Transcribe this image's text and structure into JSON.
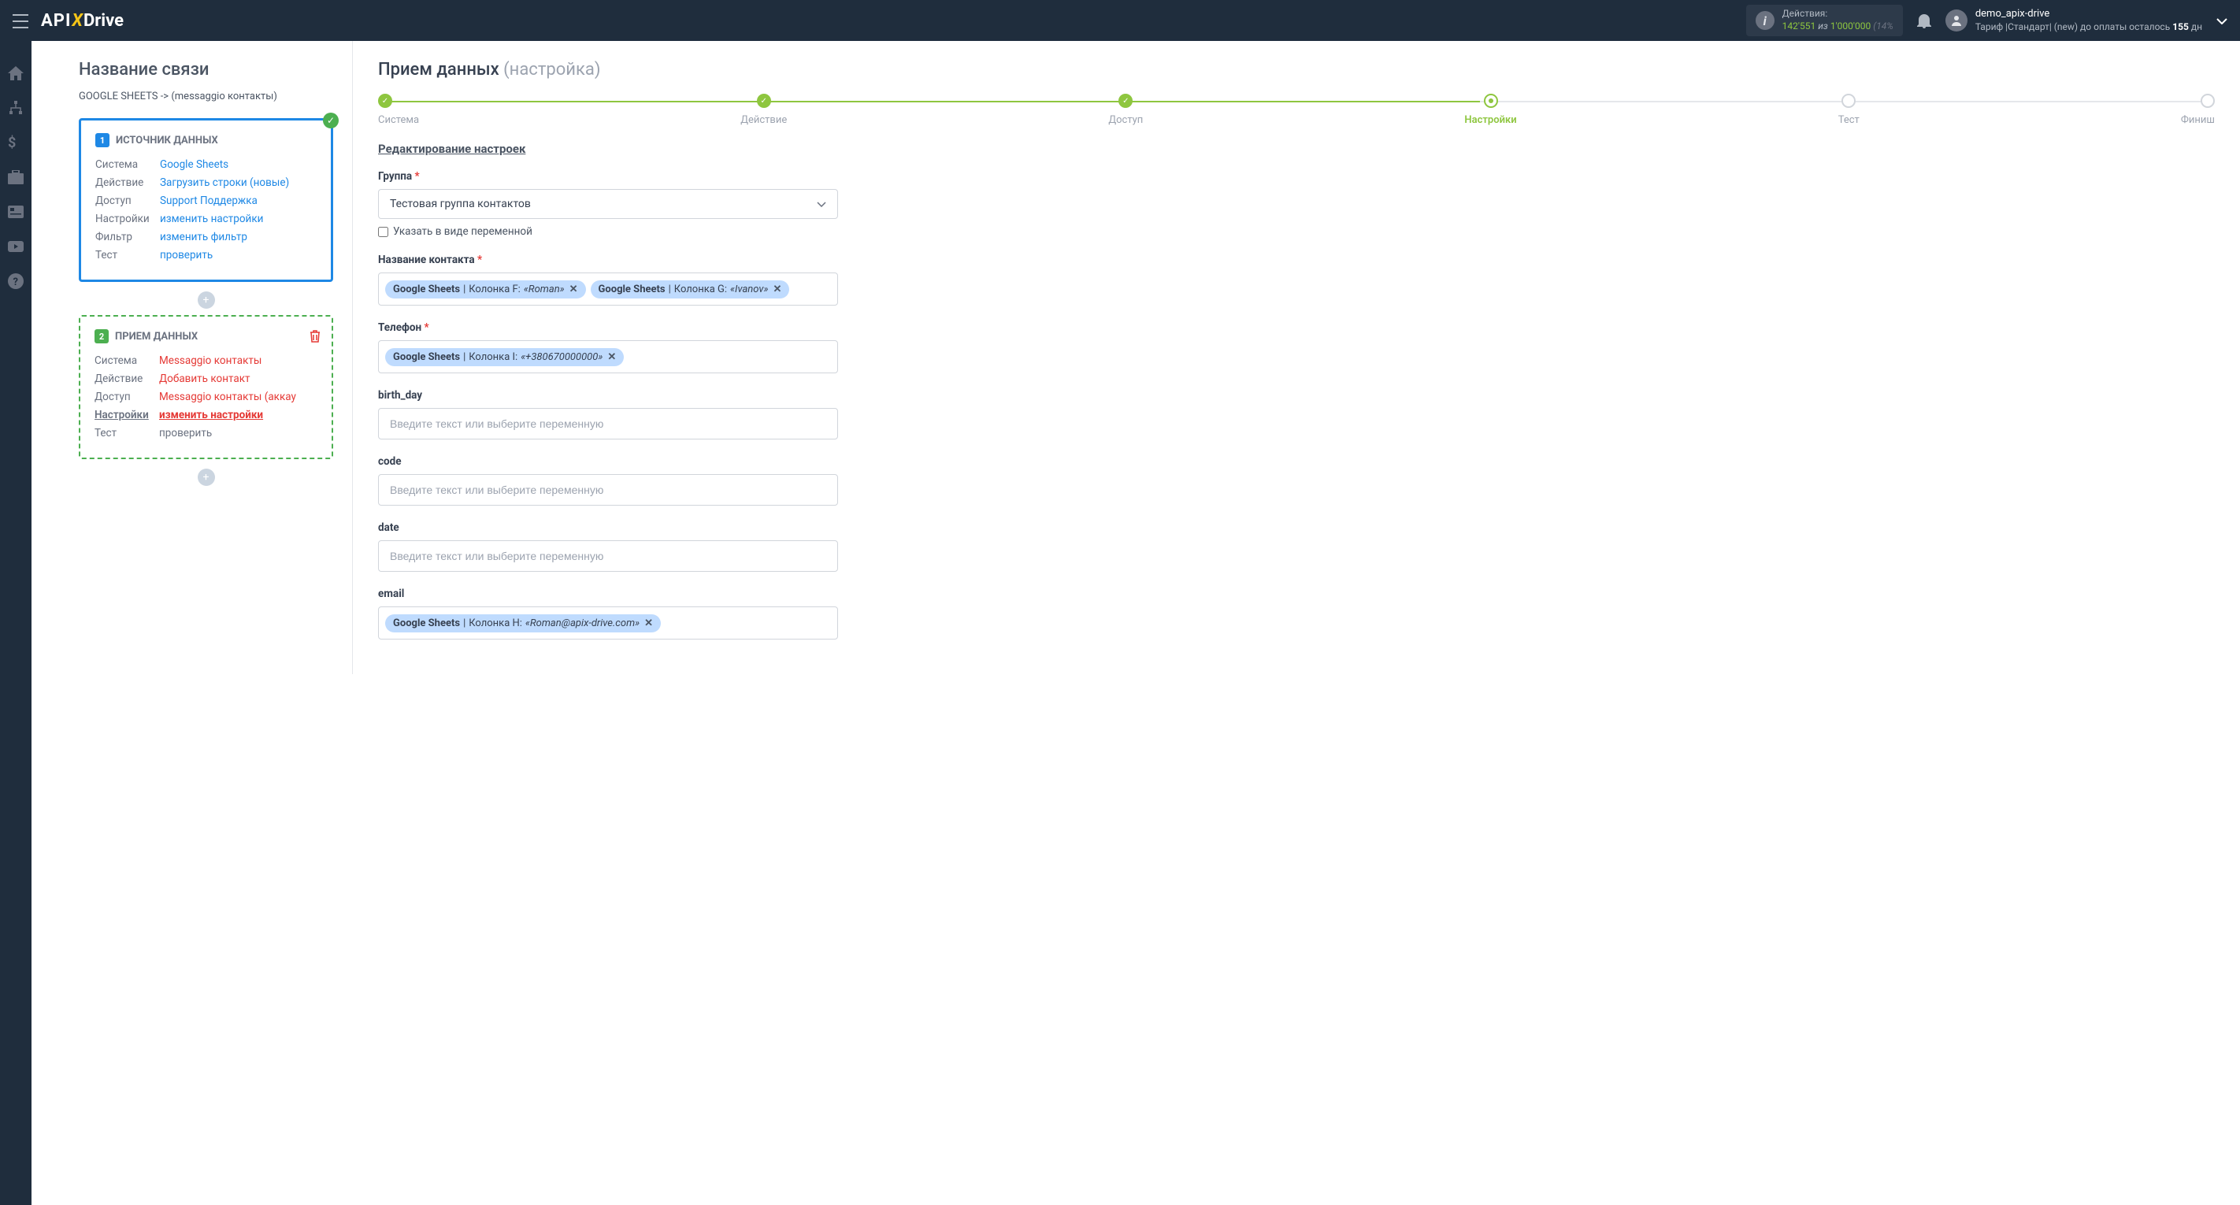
{
  "header": {
    "logo_api": "API",
    "logo_x": "X",
    "logo_drive": "Drive",
    "actions_label": "Действия:",
    "actions_count": "142'551",
    "actions_of": "из",
    "actions_total": "1'000'000",
    "actions_pct": "(14%",
    "user_name": "demo_apix-drive",
    "user_tariff_prefix": "Тариф |Стандарт| (new) до оплаты осталось ",
    "user_tariff_days": "155",
    "user_tariff_suffix": " дн"
  },
  "left": {
    "title": "Название связи",
    "subtitle": "GOOGLE SHEETS -> (messaggio контакты)",
    "source": {
      "num": "1",
      "header": "ИСТОЧНИК ДАННЫХ",
      "rows": [
        {
          "label": "Система",
          "value": "Google Sheets",
          "cls": ""
        },
        {
          "label": "Действие",
          "value": "Загрузить строки (новые)",
          "cls": ""
        },
        {
          "label": "Доступ",
          "value": "Support Поддержка",
          "cls": ""
        },
        {
          "label": "Настройки",
          "value": "изменить настройки",
          "cls": ""
        },
        {
          "label": "Фильтр",
          "value": "изменить фильтр",
          "cls": ""
        },
        {
          "label": "Тест",
          "value": "проверить",
          "cls": ""
        }
      ]
    },
    "receive": {
      "num": "2",
      "header": "ПРИЕМ ДАННЫХ",
      "rows": [
        {
          "label": "Система",
          "value": "Messaggio контакты",
          "cls": "red"
        },
        {
          "label": "Действие",
          "value": "Добавить контакт",
          "cls": "red"
        },
        {
          "label": "Доступ",
          "value": "Messaggio контакты (аккау",
          "cls": "red"
        },
        {
          "label": "Настройки",
          "value": "изменить настройки",
          "cls": "active",
          "labelcls": "active"
        },
        {
          "label": "Тест",
          "value": "проверить",
          "cls": "gray"
        }
      ]
    }
  },
  "right": {
    "title": "Прием данных",
    "title_sub": "(настройка)",
    "steps": [
      {
        "label": "Система",
        "state": "done"
      },
      {
        "label": "Действие",
        "state": "done"
      },
      {
        "label": "Доступ",
        "state": "done"
      },
      {
        "label": "Настройки",
        "state": "current"
      },
      {
        "label": "Тест",
        "state": "pending"
      },
      {
        "label": "Финиш",
        "state": "pending"
      }
    ],
    "section_title": "Редактирование настроек",
    "group": {
      "label": "Группа",
      "value": "Тестовая группа контактов",
      "checkbox": "Указать в виде переменной"
    },
    "fields": [
      {
        "label": "Название контакта",
        "required": true,
        "tags": [
          {
            "source": "Google Sheets",
            "col": "Колонка F:",
            "val": "«Roman»"
          },
          {
            "source": "Google Sheets",
            "col": "Колонка G:",
            "val": "«Ivanov»"
          }
        ]
      },
      {
        "label": "Телефон",
        "required": true,
        "tags": [
          {
            "source": "Google Sheets",
            "col": "Колонка I:",
            "val": "«+380670000000»"
          }
        ]
      },
      {
        "label": "birth_day",
        "required": false,
        "placeholder": "Введите текст или выберите переменную"
      },
      {
        "label": "code",
        "required": false,
        "placeholder": "Введите текст или выберите переменную"
      },
      {
        "label": "date",
        "required": false,
        "placeholder": "Введите текст или выберите переменную"
      },
      {
        "label": "email",
        "required": false,
        "tags": [
          {
            "source": "Google Sheets",
            "col": "Колонка H:",
            "val": "«Roman@apix-drive.com»"
          }
        ]
      }
    ]
  }
}
